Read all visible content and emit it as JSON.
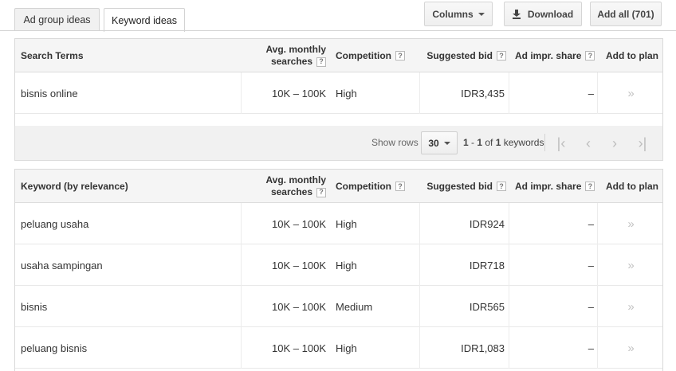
{
  "tabs": [
    {
      "label": "Ad group ideas"
    },
    {
      "label": "Keyword ideas"
    }
  ],
  "toolbar": {
    "columns_label": "Columns",
    "download_label": "Download",
    "add_all_label": "Add all (701)"
  },
  "columns": {
    "search_terms": "Search Terms",
    "keyword": "Keyword (by relevance)",
    "avg_monthly_line1": "Avg. monthly",
    "avg_monthly_line2": "searches",
    "competition": "Competition",
    "suggested_bid": "Suggested bid",
    "ad_impr_share": "Ad impr. share",
    "add_to_plan": "Add to plan",
    "help": "?"
  },
  "search_terms_rows": [
    {
      "term": "bisnis online",
      "searches": "10K – 100K",
      "competition": "High",
      "bid": "IDR3,435",
      "share": "–",
      "add": "»"
    }
  ],
  "pager": {
    "show_rows_label": "Show rows",
    "rows_value": "30",
    "range_start": "1",
    "range_sep": " - ",
    "range_end": "1",
    "of_label": " of ",
    "total": "1",
    "unit": " keywords"
  },
  "keyword_rows": [
    {
      "term": "peluang usaha",
      "searches": "10K – 100K",
      "competition": "High",
      "bid": "IDR924",
      "share": "–",
      "add": "»"
    },
    {
      "term": "usaha sampingan",
      "searches": "10K – 100K",
      "competition": "High",
      "bid": "IDR718",
      "share": "–",
      "add": "»"
    },
    {
      "term": "bisnis",
      "searches": "10K – 100K",
      "competition": "Medium",
      "bid": "IDR565",
      "share": "–",
      "add": "»"
    },
    {
      "term": "peluang bisnis",
      "searches": "10K – 100K",
      "competition": "High",
      "bid": "IDR1,083",
      "share": "–",
      "add": "»"
    }
  ]
}
